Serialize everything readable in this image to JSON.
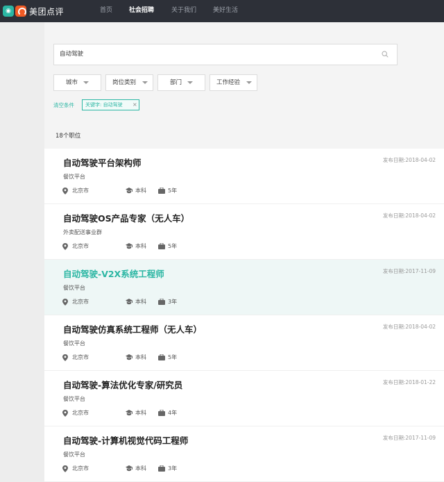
{
  "header": {
    "logo_icon": "meituan-icon",
    "logo_text": "美团点评",
    "nav": [
      "首页",
      "社会招聘",
      "关于我们",
      "美好生活"
    ],
    "active_nav": "社会招聘"
  },
  "search": {
    "value": "自动驾驶",
    "icon": "search-icon"
  },
  "filters": [
    "城市",
    "岗位类别",
    "部门",
    "工作经验"
  ],
  "clear_label": "清空条件",
  "active_tag": "关键字: 自动驾驶",
  "result_count": "18个职位",
  "colors": {
    "accent": "#2bb6a3",
    "topbar": "#2d3038"
  },
  "jobs": [
    {
      "title": "自动驾驶平台架构师",
      "date": "发布日期:2018-04-02",
      "dept": "餐饮平台",
      "city": "北京市",
      "edu": "本科",
      "exp": "5年"
    },
    {
      "title": "自动驾驶OS产品专家（无人车）",
      "date": "发布日期:2018-04-02",
      "dept": "外卖配送事业群",
      "city": "北京市",
      "edu": "本科",
      "exp": "5年"
    },
    {
      "title": "自动驾驶-V2X系统工程师",
      "date": "发布日期:2017-11-09",
      "dept": "餐饮平台",
      "city": "北京市",
      "edu": "本科",
      "exp": "3年",
      "highlighted": true
    },
    {
      "title": "自动驾驶仿真系统工程师（无人车）",
      "date": "发布日期:2018-04-02",
      "dept": "餐饮平台",
      "city": "北京市",
      "edu": "本科",
      "exp": "5年"
    },
    {
      "title": "自动驾驶-算法优化专家/研究员",
      "date": "发布日期:2018-01-22",
      "dept": "餐饮平台",
      "city": "北京市",
      "edu": "本科",
      "exp": "4年"
    },
    {
      "title": "自动驾驶-计算机视觉代码工程师",
      "date": "发布日期:2017-11-09",
      "dept": "餐饮平台",
      "city": "北京市",
      "edu": "本科",
      "exp": "3年"
    }
  ]
}
